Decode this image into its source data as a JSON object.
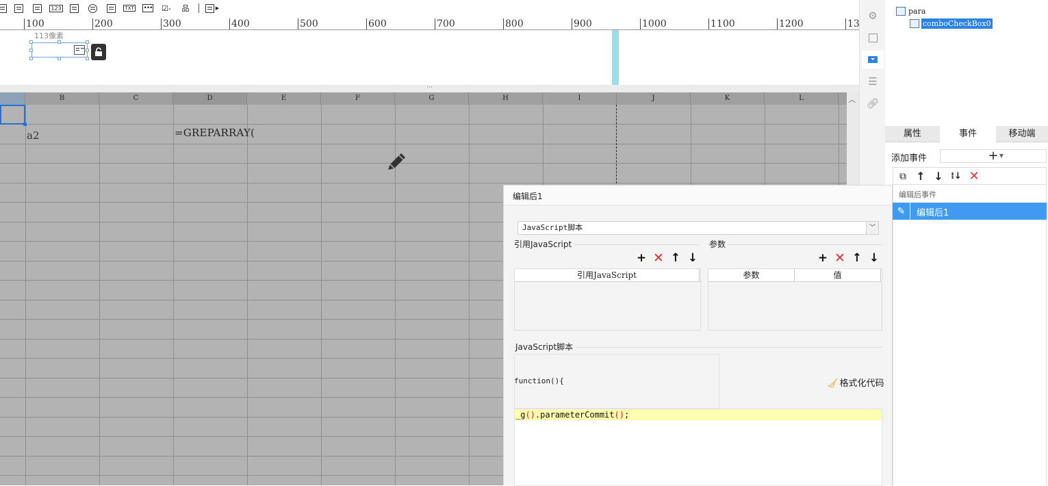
{
  "toolbar": {
    "items": [
      "dropdown-icon",
      "form-icon",
      "calendar-icon",
      "number-field-icon",
      "text-area-icon",
      "radio-group-icon",
      "checkbox-group-icon",
      "text-icon",
      "password-icon",
      "checkbox-icon",
      "tree-icon",
      "frame-icon"
    ],
    "number_field_text": "123",
    "text_field_text": "TXT"
  },
  "ruler": {
    "labels": [
      "100",
      "200",
      "300",
      "400",
      "500",
      "600",
      "700",
      "800",
      "900",
      "1000",
      "1100",
      "1200",
      "13"
    ]
  },
  "canvas": {
    "width_label": "113像素"
  },
  "grid": {
    "columns": [
      "B",
      "C",
      "D",
      "E",
      "F",
      "G",
      "H",
      "I",
      "J",
      "K",
      "L"
    ],
    "cell_a2": "a2",
    "cell_formula": "=GREPARRAY("
  },
  "tree": {
    "root": "para",
    "child": "comboCheckBox0"
  },
  "props": {
    "tabs": [
      "属性",
      "事件",
      "移动端"
    ],
    "active_tab": "事件",
    "add_event_label": "添加事件",
    "add_event_plus": "+",
    "event_group": "编辑后事件",
    "event_item": "编辑后1"
  },
  "dialog": {
    "title": "编辑后1",
    "type_value": "JavaScript脚本",
    "ref_js_section": "引用JavaScript",
    "params_section": "参数",
    "ref_js_header": "引用JavaScript",
    "param_header": "参数",
    "value_header": "值",
    "script_section": "JavaScript脚本",
    "function_open": "function(){",
    "format_label": "格式化代码",
    "code_prefix": "_g",
    "code_paren1": "()",
    "code_mid": ".parameterCommit",
    "code_paren2": "()",
    "code_end": ";"
  },
  "colors": {
    "accent": "#2a82e4",
    "selected_event": "#3f9af0",
    "delete": "#e53030",
    "code_highlight": "#ffffb0"
  }
}
